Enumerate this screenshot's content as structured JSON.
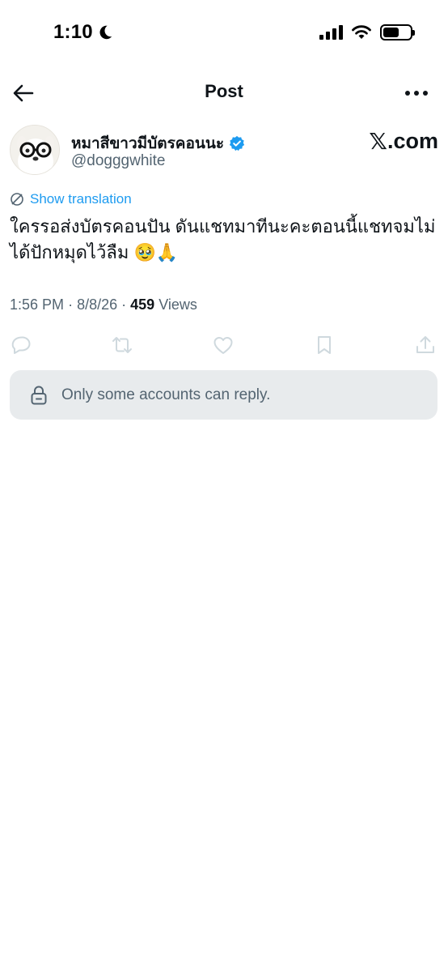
{
  "status_bar": {
    "time": "1:10",
    "icons": [
      "moon-icon",
      "signal-icon",
      "wifi-icon",
      "battery-icon"
    ]
  },
  "header": {
    "title": "Post",
    "back_icon": "back-arrow-icon",
    "more_icon": "more-icon"
  },
  "post": {
    "author": {
      "display_name": "หมาสีขาวมีบัตรคอนนะ",
      "handle": "@dogggwhite",
      "verified": true
    },
    "watermark": {
      "x": "𝕏",
      "domain": ".com"
    },
    "translate_label": "Show translation",
    "text": "ใครรอส่งบัตรคอนปัน ดันแชทมาทีนะคะตอนนี้แชทจมไม่ได้ปักหมุดไว้ลืม 🥹🙏",
    "time": "1:56 PM",
    "separator": "·",
    "date": "8/8/26",
    "views_count": "459",
    "views_label": "Views"
  },
  "actions": [
    "reply-icon",
    "repost-icon",
    "like-icon",
    "bookmark-icon",
    "share-icon"
  ],
  "reply_restriction": {
    "text": "Only some accounts can reply."
  },
  "colors": {
    "accent": "#1d9bf0",
    "secondary_text": "#536471",
    "primary_text": "#0f1419",
    "reply_box_bg": "#e8ebed"
  }
}
